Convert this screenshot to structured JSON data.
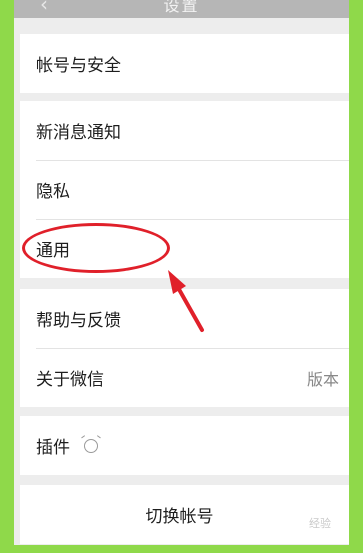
{
  "header": {
    "back_icon": "chevron-left-icon",
    "title": "设置"
  },
  "groups": [
    {
      "items": [
        {
          "label": "帐号与安全"
        }
      ]
    },
    {
      "items": [
        {
          "label": "新消息通知"
        },
        {
          "label": "隐私"
        },
        {
          "label": "通用"
        }
      ]
    },
    {
      "items": [
        {
          "label": "帮助与反馈"
        },
        {
          "label": "关于微信",
          "value": "版本"
        }
      ]
    },
    {
      "items": [
        {
          "label": "插件",
          "icon": "plugin-icon"
        }
      ]
    },
    {
      "items": [
        {
          "label": "切换帐号"
        }
      ]
    }
  ],
  "annotation": {
    "color": "#e0202a"
  },
  "watermark": "经验"
}
